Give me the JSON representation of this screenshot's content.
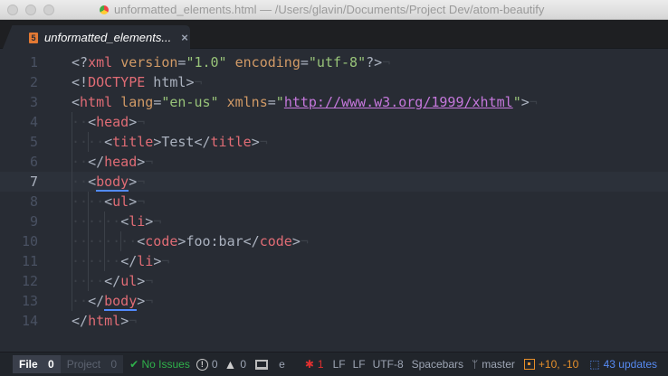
{
  "window": {
    "title": "unformatted_elements.html — /Users/glavin/Documents/Project Dev/atom-beautify"
  },
  "tab": {
    "label": "unformatted_elements...",
    "icon": "html5-icon",
    "close": "×"
  },
  "editor": {
    "current_line": 7,
    "lines": [
      [
        [
          "p",
          "<?"
        ],
        [
          "t",
          "xml"
        ],
        [
          "x",
          " "
        ],
        [
          "a",
          "version"
        ],
        [
          "p",
          "="
        ],
        [
          "s",
          "\"1.0\""
        ],
        [
          "x",
          " "
        ],
        [
          "a",
          "encoding"
        ],
        [
          "p",
          "="
        ],
        [
          "s",
          "\"utf-8\""
        ],
        [
          "p",
          "?>"
        ]
      ],
      [
        [
          "p",
          "<!"
        ],
        [
          "t",
          "DOCTYPE"
        ],
        [
          "x",
          " html"
        ],
        [
          "p",
          ">"
        ]
      ],
      [
        [
          "p",
          "<"
        ],
        [
          "t",
          "html"
        ],
        [
          "x",
          " "
        ],
        [
          "a",
          "lang"
        ],
        [
          "p",
          "="
        ],
        [
          "s",
          "\"en-us\""
        ],
        [
          "x",
          " "
        ],
        [
          "a",
          "xmlns"
        ],
        [
          "p",
          "="
        ],
        [
          "s",
          "\""
        ],
        [
          "l",
          "http://www.w3.org/1999/xhtml"
        ],
        [
          "s",
          "\""
        ],
        [
          "p",
          ">"
        ]
      ],
      [
        [
          "w",
          "··"
        ],
        [
          "p",
          "<"
        ],
        [
          "t",
          "head"
        ],
        [
          "p",
          ">"
        ]
      ],
      [
        [
          "w",
          "····"
        ],
        [
          "p",
          "<"
        ],
        [
          "t",
          "title"
        ],
        [
          "p",
          ">"
        ],
        [
          "x",
          "Test"
        ],
        [
          "p",
          "</"
        ],
        [
          "t",
          "title"
        ],
        [
          "p",
          ">"
        ]
      ],
      [
        [
          "w",
          "··"
        ],
        [
          "p",
          "</"
        ],
        [
          "t",
          "head"
        ],
        [
          "p",
          ">"
        ]
      ],
      [
        [
          "w",
          "··"
        ],
        [
          "p",
          "<"
        ],
        [
          "m",
          "body"
        ],
        [
          "p",
          ">"
        ]
      ],
      [
        [
          "w",
          "····"
        ],
        [
          "p",
          "<"
        ],
        [
          "t",
          "ul"
        ],
        [
          "p",
          ">"
        ]
      ],
      [
        [
          "w",
          "······"
        ],
        [
          "p",
          "<"
        ],
        [
          "t",
          "li"
        ],
        [
          "p",
          ">"
        ]
      ],
      [
        [
          "w",
          "········"
        ],
        [
          "p",
          "<"
        ],
        [
          "t",
          "code"
        ],
        [
          "p",
          ">"
        ],
        [
          "x",
          "foo:bar"
        ],
        [
          "p",
          "</"
        ],
        [
          "t",
          "code"
        ],
        [
          "p",
          ">"
        ]
      ],
      [
        [
          "w",
          "······"
        ],
        [
          "p",
          "</"
        ],
        [
          "t",
          "li"
        ],
        [
          "p",
          ">"
        ]
      ],
      [
        [
          "w",
          "····"
        ],
        [
          "p",
          "</"
        ],
        [
          "t",
          "ul"
        ],
        [
          "p",
          ">"
        ]
      ],
      [
        [
          "w",
          "··"
        ],
        [
          "p",
          "</"
        ],
        [
          "m",
          "body"
        ],
        [
          "p",
          ">"
        ]
      ],
      [
        [
          "p",
          "</"
        ],
        [
          "t",
          "html"
        ],
        [
          "p",
          ">"
        ]
      ]
    ],
    "eol": "¬"
  },
  "status": {
    "file_label": "File",
    "file_count": "0",
    "project_label": "Project",
    "project_count": "0",
    "no_issues": "✔ No Issues",
    "errors": "0",
    "warnings": "0",
    "terminal": "e",
    "bug_count": "1",
    "lf1": "LF",
    "lf2": "LF",
    "encoding": "UTF-8",
    "indent": "Spacebars",
    "branch": "master",
    "diff": "+10, -10",
    "updates": "43 updates"
  }
}
